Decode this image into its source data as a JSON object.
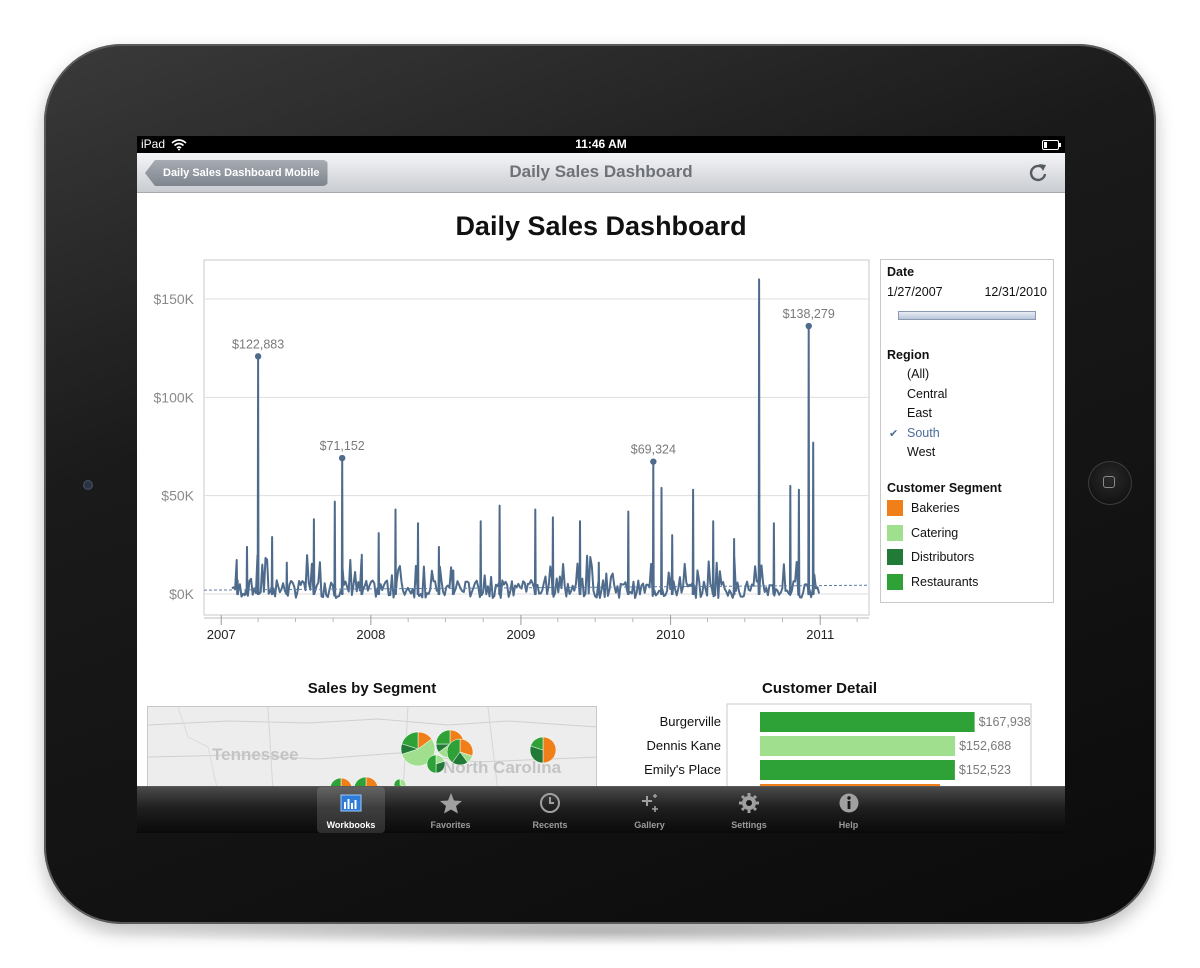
{
  "status_bar": {
    "carrier": "iPad",
    "time": "11:46 AM"
  },
  "nav_bar": {
    "back_label": "Daily Sales Dashboard Mobile",
    "title": "Daily Sales Dashboard"
  },
  "dashboard": {
    "title": "Daily Sales Dashboard",
    "segment_title": "Sales by Segment",
    "detail_title": "Customer Detail"
  },
  "filters": {
    "date": {
      "label": "Date",
      "start": "1/27/2007",
      "end": "12/31/2010"
    },
    "region": {
      "label": "Region",
      "options": [
        "(All)",
        "Central",
        "East",
        "South",
        "West"
      ],
      "selected": "South"
    },
    "segment_legend": {
      "label": "Customer Segment",
      "items": [
        {
          "name": "Bakeries",
          "color": "#f07f1a"
        },
        {
          "name": "Catering",
          "color": "#9fdf8e"
        },
        {
          "name": "Distributors",
          "color": "#217a36"
        },
        {
          "name": "Restaurants",
          "color": "#2ea236"
        }
      ]
    }
  },
  "map_labels": {
    "state1": "Tennessee",
    "state2": "North Carolina"
  },
  "tab_bar": {
    "active": "Workbooks",
    "tabs": [
      {
        "label": "Workbooks",
        "icon": "bar-chart-icon"
      },
      {
        "label": "Favorites",
        "icon": "star-icon"
      },
      {
        "label": "Recents",
        "icon": "clock-icon"
      },
      {
        "label": "Gallery",
        "icon": "sparkle-icon"
      },
      {
        "label": "Settings",
        "icon": "gear-icon"
      },
      {
        "label": "Help",
        "icon": "info-icon"
      }
    ]
  },
  "chart_data": [
    {
      "type": "line",
      "title": "",
      "xlabel": "",
      "ylabel": "",
      "x_ticks": [
        "2007",
        "2008",
        "2009",
        "2010",
        "2011"
      ],
      "y_ticks": [
        "$0K",
        "$50K",
        "$100K",
        "$150K"
      ],
      "ylim": [
        0,
        165000
      ],
      "xlim": [
        "2006-11-20",
        "2011-04-30"
      ],
      "line_color": "#4f6b8c",
      "grid": true,
      "peak_labels": [
        {
          "x": "2007-04-01",
          "y": 122883,
          "label": "$122,883"
        },
        {
          "x": "2007-10-23",
          "y": 71152,
          "label": "$71,152"
        },
        {
          "x": "2009-11-20",
          "y": 69324,
          "label": "$69,324"
        },
        {
          "x": "2010-12-04",
          "y": 138279,
          "label": "$138,279"
        }
      ],
      "spikes": [
        {
          "x": "2007-02-10",
          "y": 9000
        },
        {
          "x": "2007-03-05",
          "y": 26000
        },
        {
          "x": "2007-05-05",
          "y": 31000
        },
        {
          "x": "2007-06-10",
          "y": 18000
        },
        {
          "x": "2007-08-15",
          "y": 40000
        },
        {
          "x": "2007-10-05",
          "y": 49000
        },
        {
          "x": "2007-12-10",
          "y": 22000
        },
        {
          "x": "2008-01-20",
          "y": 33000
        },
        {
          "x": "2008-03-01",
          "y": 45000
        },
        {
          "x": "2008-04-25",
          "y": 38000
        },
        {
          "x": "2008-06-15",
          "y": 26000
        },
        {
          "x": "2008-07-20",
          "y": 14000
        },
        {
          "x": "2008-09-25",
          "y": 39000
        },
        {
          "x": "2008-11-10",
          "y": 47000
        },
        {
          "x": "2009-02-05",
          "y": 45000
        },
        {
          "x": "2009-03-20",
          "y": 41000
        },
        {
          "x": "2009-05-25",
          "y": 39000
        },
        {
          "x": "2009-07-10",
          "y": 18000
        },
        {
          "x": "2009-09-20",
          "y": 44000
        },
        {
          "x": "2009-12-10",
          "y": 56000
        },
        {
          "x": "2010-01-05",
          "y": 32000
        },
        {
          "x": "2010-02-25",
          "y": 55000
        },
        {
          "x": "2010-04-15",
          "y": 39000
        },
        {
          "x": "2010-06-05",
          "y": 30000
        },
        {
          "x": "2010-08-05",
          "y": 162000
        },
        {
          "x": "2010-09-10",
          "y": 38000
        },
        {
          "x": "2010-10-20",
          "y": 57000
        },
        {
          "x": "2010-11-10",
          "y": 55000
        },
        {
          "x": "2010-12-15",
          "y": 79000
        }
      ]
    },
    {
      "type": "bar",
      "title": "Customer Detail",
      "categories": [
        "Burgerville",
        "Dennis Kane",
        "Emily's Place"
      ],
      "values": [
        167938,
        152688,
        152523
      ],
      "labels": [
        "$167,938",
        "$152,688",
        "$152,523"
      ],
      "colors": [
        "#2ea236",
        "#9fdf8e",
        "#2ea236"
      ],
      "partial_next_bar_color": "#f07f1a"
    }
  ]
}
